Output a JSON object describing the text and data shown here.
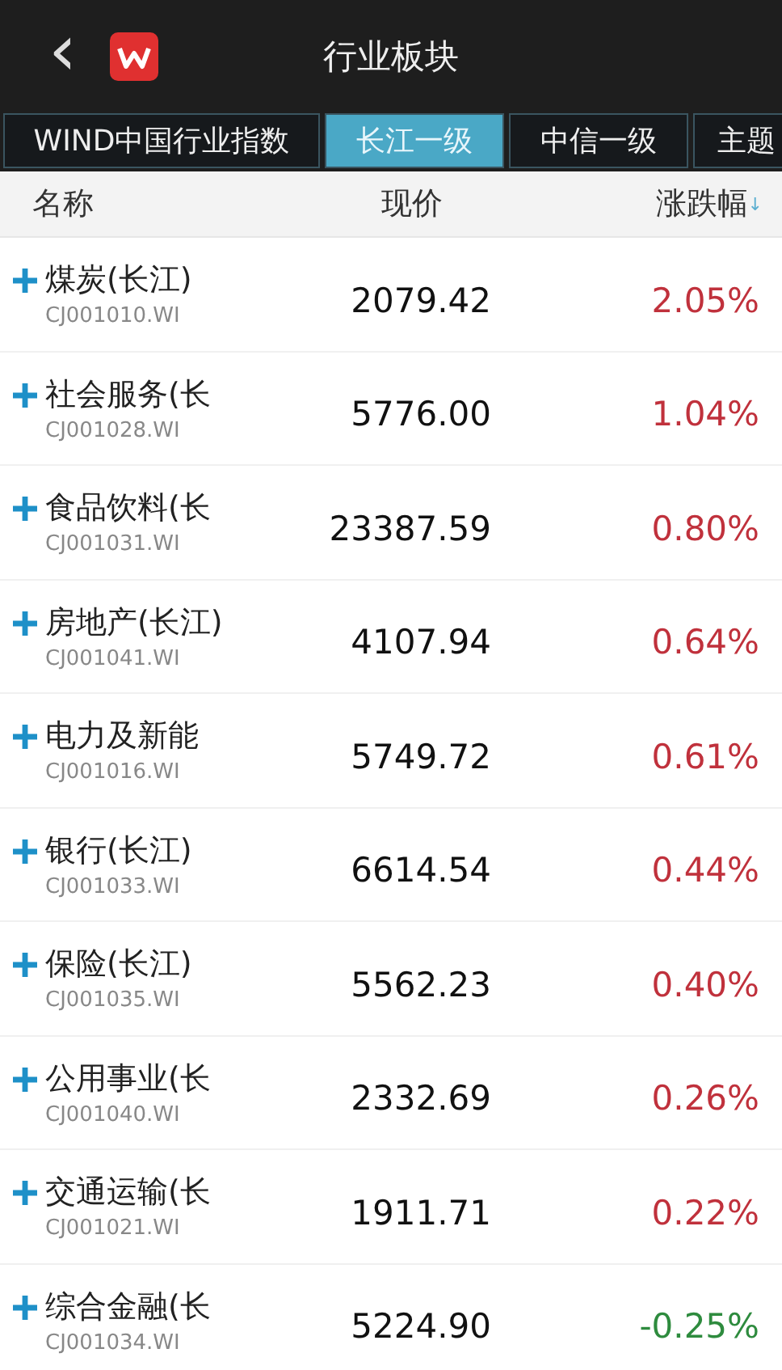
{
  "header": {
    "back_icon": "‹",
    "title": "行业板块"
  },
  "tabs": [
    {
      "label": "WIND中国行业指数",
      "selected": false
    },
    {
      "label": "长江一级",
      "selected": true
    },
    {
      "label": "中信一级",
      "selected": false
    },
    {
      "label": "主题",
      "selected": false
    }
  ],
  "columns": {
    "name": "名称",
    "price": "现价",
    "change": "涨跌幅",
    "sort_indicator": "↓"
  },
  "rows": [
    {
      "name": "煤炭(长江)",
      "code": "CJ001010.WI",
      "price": "2079.42",
      "change": "2.05%",
      "color": "#c0313c"
    },
    {
      "name": "社会服务(长",
      "code": "CJ001028.WI",
      "price": "5776.00",
      "change": "1.04%",
      "color": "#c0313c"
    },
    {
      "name": "食品饮料(长",
      "code": "CJ001031.WI",
      "price": "23387.59",
      "change": "0.80%",
      "color": "#c0313c"
    },
    {
      "name": "房地产(长江)",
      "code": "CJ001041.WI",
      "price": "4107.94",
      "change": "0.64%",
      "color": "#c0313c"
    },
    {
      "name": "电力及新能",
      "code": "CJ001016.WI",
      "price": "5749.72",
      "change": "0.61%",
      "color": "#c0313c"
    },
    {
      "name": "银行(长江)",
      "code": "CJ001033.WI",
      "price": "6614.54",
      "change": "0.44%",
      "color": "#c0313c"
    },
    {
      "name": "保险(长江)",
      "code": "CJ001035.WI",
      "price": "5562.23",
      "change": "0.40%",
      "color": "#c0313c"
    },
    {
      "name": "公用事业(长",
      "code": "CJ001040.WI",
      "price": "2332.69",
      "change": "0.26%",
      "color": "#c0313c"
    },
    {
      "name": "交通运输(长",
      "code": "CJ001021.WI",
      "price": "1911.71",
      "change": "0.22%",
      "color": "#c0313c"
    },
    {
      "name": "综合金融(长",
      "code": "CJ001034.WI",
      "price": "5224.90",
      "change": "-0.25%",
      "color": "#2e8b3e"
    }
  ]
}
